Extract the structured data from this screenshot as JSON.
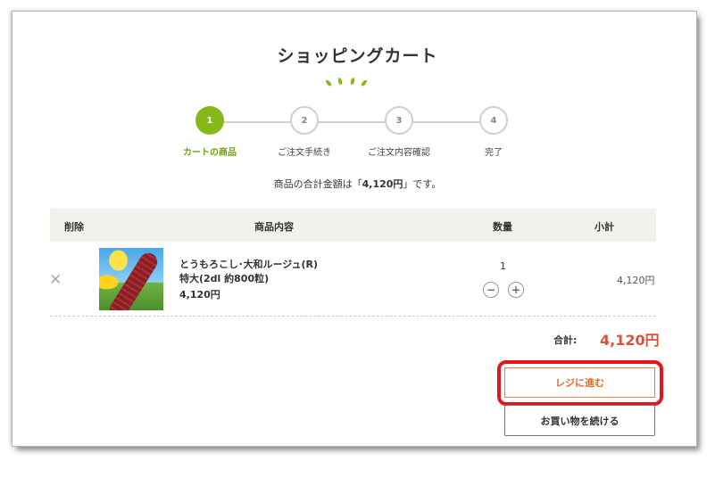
{
  "page": {
    "title": "ショッピングカート",
    "accent_color": "#86b817",
    "price_color": "#d9533c",
    "highlight_color": "#e8141b"
  },
  "steps": [
    {
      "number": "1",
      "label": "カートの商品",
      "state": "active"
    },
    {
      "number": "2",
      "label": "ご注文手続き",
      "state": "todo"
    },
    {
      "number": "3",
      "label": "ご注文内容確認",
      "state": "todo"
    },
    {
      "number": "4",
      "label": "完了",
      "state": "todo"
    }
  ],
  "summary": {
    "prefix": "商品の合計金額は「",
    "amount": "4,120円",
    "suffix": "」です。"
  },
  "table": {
    "headers": {
      "delete": "削除",
      "item": "商品内容",
      "quantity": "数量",
      "subtotal": "小計"
    },
    "items": [
      {
        "name": "とうもろこし･大和ルージュ(R)",
        "variant": "特大(2dl 約800粒)",
        "price": "4,120円",
        "quantity": "1",
        "subtotal": "4,120円",
        "image": "red-corn-sunflower-photo"
      }
    ]
  },
  "totals": {
    "label": "合計:",
    "value": "4,120円"
  },
  "buttons": {
    "checkout": "レジに進む",
    "continue_shopping": "お買い物を続ける",
    "minus_symbol": "−",
    "plus_symbol": "+",
    "remove_symbol": "✕"
  }
}
